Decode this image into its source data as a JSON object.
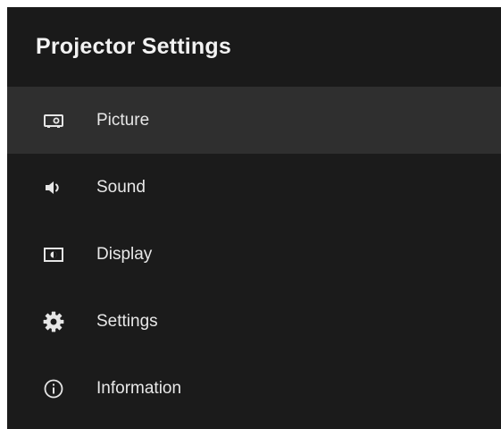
{
  "header": {
    "title": "Projector Settings"
  },
  "menu": {
    "items": [
      {
        "label": "Picture",
        "icon": "projector-icon",
        "selected": true
      },
      {
        "label": "Sound",
        "icon": "speaker-icon",
        "selected": false
      },
      {
        "label": "Display",
        "icon": "display-icon",
        "selected": false
      },
      {
        "label": "Settings",
        "icon": "gear-icon",
        "selected": false
      },
      {
        "label": "Information",
        "icon": "info-icon",
        "selected": false
      }
    ]
  },
  "colors": {
    "background": "#1b1b1b",
    "selected_row": "#2f2f2f",
    "text": "#e8e8e8"
  }
}
